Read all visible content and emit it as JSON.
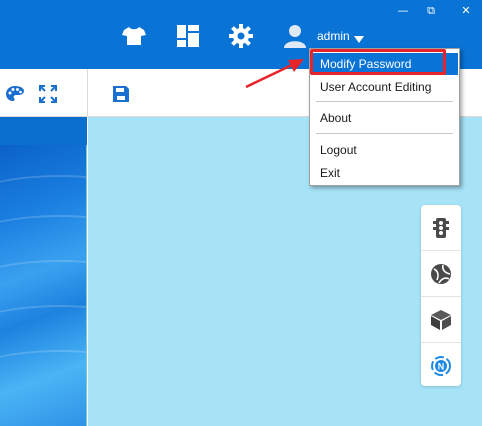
{
  "window": {
    "controls": {
      "minimize": "—",
      "restore": "⧉",
      "close": "✕"
    }
  },
  "header": {
    "icons": [
      "tshirt-icon",
      "dashboard-icon",
      "gear-icon",
      "user-icon"
    ],
    "user_name": "admin"
  },
  "toolbar": {
    "icons": [
      "palette-icon",
      "fullscreen-icon",
      "save-icon"
    ]
  },
  "user_menu": {
    "items": [
      {
        "label": "Modify Password",
        "active": true
      },
      {
        "label": "User Account Editing"
      },
      {
        "label": "About"
      },
      {
        "label": "Logout"
      },
      {
        "label": "Exit"
      }
    ]
  },
  "side_tools": {
    "icons": [
      "traffic-light-icon",
      "globe-icon",
      "cube-icon",
      "navigation-icon"
    ]
  },
  "colors": {
    "header_bg": "#0a74d6",
    "main_bg": "#a6e3f7",
    "highlight": "#e8232a",
    "accent": "#0a74d6"
  }
}
